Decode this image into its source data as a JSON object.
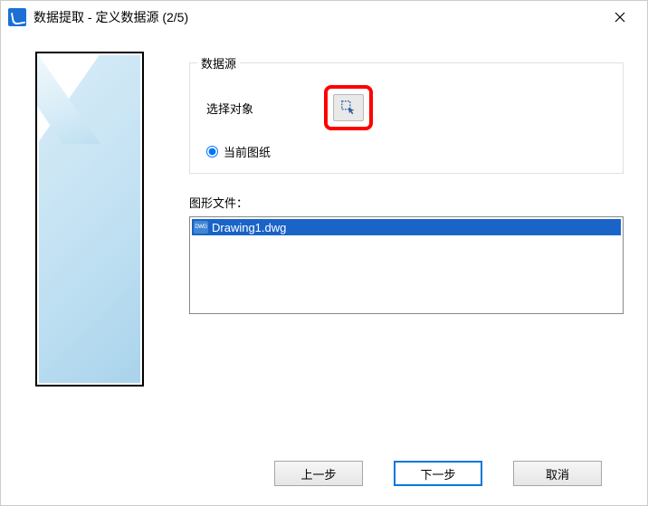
{
  "window": {
    "title": "数据提取 - 定义数据源 (2/5)"
  },
  "dataSource": {
    "legend": "数据源",
    "selectObjectsLabel": "选择对象",
    "currentDrawingLabel": "当前图纸"
  },
  "drawingFiles": {
    "label": "图形文件：",
    "items": [
      "Drawing1.dwg"
    ]
  },
  "footer": {
    "back": "上一步",
    "next": "下一步",
    "cancel": "取消"
  }
}
